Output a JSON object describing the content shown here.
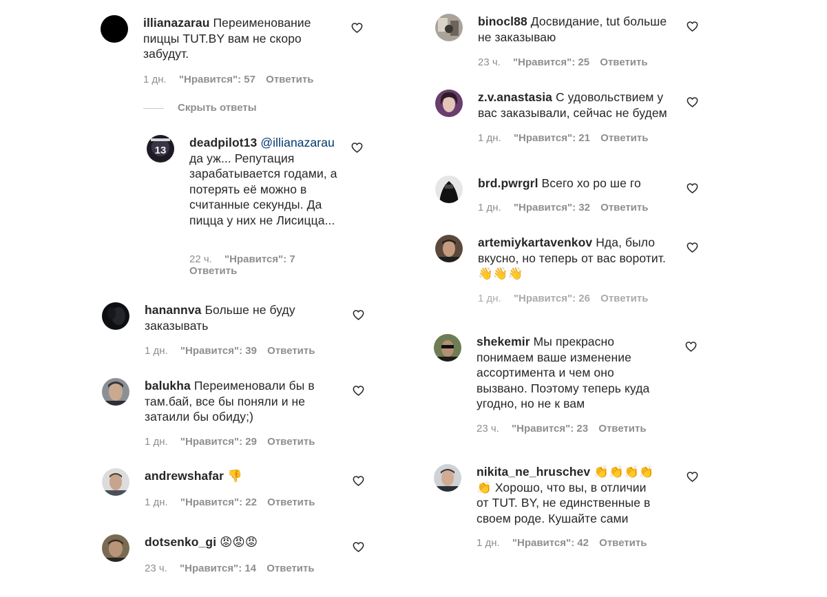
{
  "colors": {
    "username": "#262626",
    "meta": "#8e8e8e",
    "mention": "#00376b",
    "background": "#ffffff"
  },
  "icons": {
    "like": "heart-outline-icon"
  },
  "hide_replies_label": "Скрыть ответы",
  "left": [
    {
      "user": "illianazarau",
      "text": "Переименование пиццы TUT.BY вам не скоро забудут.",
      "time": "1 дн.",
      "likes": "\"Нравится\": 57",
      "reply": "Ответить"
    },
    {
      "user": "deadpilot13",
      "mention": "@illianazarau",
      "text": "да уж... Репутация зарабатывается годами, а потерять её можно в считанные секунды. Да пицца у них не Лисицца...",
      "time": "22 ч.",
      "likes": "\"Нравится\": 7",
      "reply": "Ответить"
    },
    {
      "user": "hanannva",
      "text": "Больше не буду заказывать",
      "time": "1 дн.",
      "likes": "\"Нравится\": 39",
      "reply": "Ответить"
    },
    {
      "user": "balukha",
      "text": "Переименовали бы в там.бай, все бы поняли и не затаили бы обиду;)",
      "time": "1 дн.",
      "likes": "\"Нравится\": 29",
      "reply": "Ответить"
    },
    {
      "user": "andrewshafar",
      "text": "👎",
      "time": "1 дн.",
      "likes": "\"Нравится\": 22",
      "reply": "Ответить"
    },
    {
      "user": "dotsenko_gi",
      "text": "😡😡😡",
      "time": "23 ч.",
      "likes": "\"Нравится\": 14",
      "reply": "Ответить"
    }
  ],
  "right": [
    {
      "user": "binocl88",
      "text": "Досвидание, tut больше не заказываю",
      "time": "23 ч.",
      "likes": "\"Нравится\": 25",
      "reply": "Ответить"
    },
    {
      "user": "z.v.anastasia",
      "text": "С удовольствием у вас заказывали, сейчас не будем",
      "time": "1 дн.",
      "likes": "\"Нравится\": 21",
      "reply": "Ответить"
    },
    {
      "user": "brd.pwrgrl",
      "text": "Всего хо ро ше го",
      "time": "1 дн.",
      "likes": "\"Нравится\": 32",
      "reply": "Ответить"
    },
    {
      "user": "artemiykartavenkov",
      "text": "Нда, было вкусно, но теперь от вас воротит. 👋👋👋",
      "time": "1 дн.",
      "likes": "\"Нравится\": 26",
      "reply": "Ответить"
    },
    {
      "user": "shekemir",
      "text": "Мы прекрасно понимаем ваше изменение ассортимента и чем оно вызвано. Поэтому теперь куда угодно, но не к вам",
      "time": "23 ч.",
      "likes": "\"Нравится\": 23",
      "reply": "Ответить"
    },
    {
      "user": "nikita_ne_hruschev",
      "text": "👏👏👏👏👏 Хорошо, что вы, в отличии от TUT. BY, не единственные в своем роде. Кушайте сами",
      "time": "1 дн.",
      "likes": "\"Нравится\": 42",
      "reply": "Ответить"
    }
  ]
}
